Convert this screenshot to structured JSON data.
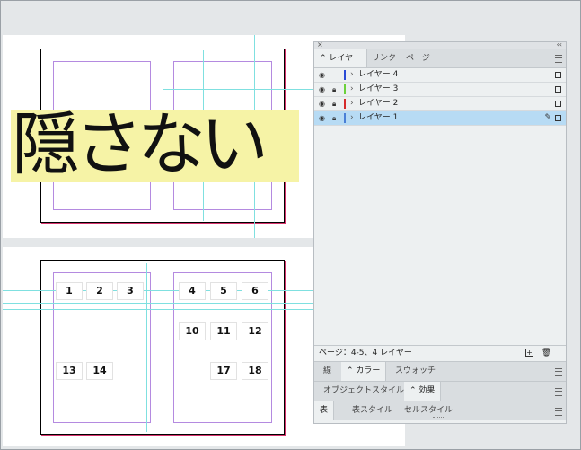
{
  "canvas": {
    "title_text": "隠さない",
    "page_numbers_left": [
      "1",
      "2",
      "3",
      "13",
      "14"
    ],
    "page_numbers_right": [
      "4",
      "5",
      "6",
      "10",
      "11",
      "12",
      "17",
      "18"
    ]
  },
  "panel": {
    "close_glyph": "×",
    "collapse_glyph": "‹‹",
    "tabs": [
      "レイヤー",
      "リンク",
      "ページ"
    ],
    "tab_prefix": "⌃",
    "layers": [
      {
        "name": "レイヤー 4",
        "color": "#2b4bd6",
        "locked": false,
        "selected": false
      },
      {
        "name": "レイヤー 3",
        "color": "#6cd13b",
        "locked": true,
        "selected": false
      },
      {
        "name": "レイヤー 2",
        "color": "#d62b2b",
        "locked": true,
        "selected": false
      },
      {
        "name": "レイヤー 1",
        "color": "#4a7fd6",
        "locked": true,
        "selected": true
      }
    ],
    "status_text": "ページ：4-5、4 レイヤー",
    "sub1_tabs": [
      "線",
      "カラー",
      "スウォッチ"
    ],
    "sub2_tabs": [
      "オブジェクトスタイル",
      "効果"
    ],
    "sub3_tabs": [
      "表",
      "表スタイル",
      "セルスタイル"
    ]
  },
  "colors": {
    "selection": "#b7dbf4",
    "highlight": "#f6f3a6",
    "guides": "#7fe0e0",
    "margins": "#b48ae0"
  }
}
